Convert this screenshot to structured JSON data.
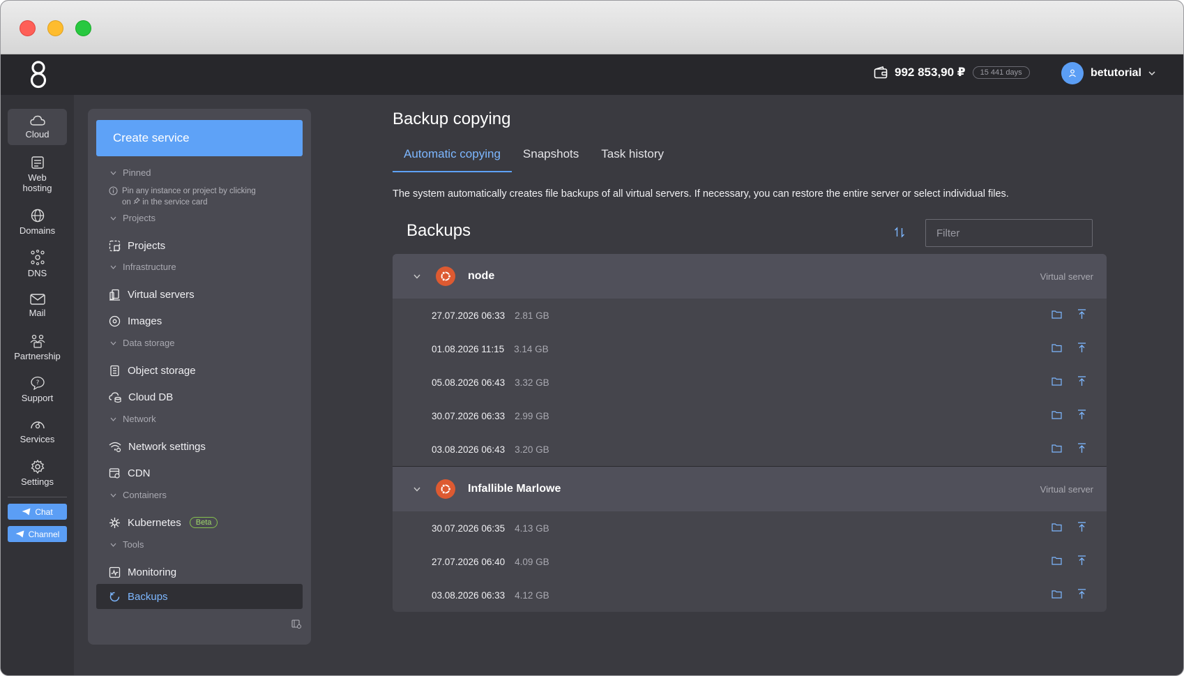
{
  "header": {
    "balance": "992 853,90 ₽",
    "days": "15 441 days",
    "username": "betutorial"
  },
  "rail": {
    "items": [
      {
        "label": "Cloud",
        "icon": "cloud-icon"
      },
      {
        "label": "Web hosting",
        "icon": "web-hosting-icon"
      },
      {
        "label": "Domains",
        "icon": "globe-icon"
      },
      {
        "label": "DNS",
        "icon": "dns-icon"
      },
      {
        "label": "Mail",
        "icon": "mail-icon"
      },
      {
        "label": "Partnership",
        "icon": "partnership-icon"
      },
      {
        "label": "Support",
        "icon": "support-icon"
      },
      {
        "label": "Services",
        "icon": "services-icon"
      },
      {
        "label": "Settings",
        "icon": "gear-icon"
      }
    ],
    "chat_label": "Chat",
    "channel_label": "Channel"
  },
  "panel": {
    "create_label": "Create service",
    "sections": {
      "pinned": "Pinned",
      "projects": "Projects",
      "infrastructure": "Infrastructure",
      "data_storage": "Data storage",
      "network": "Network",
      "containers": "Containers",
      "tools": "Tools"
    },
    "pinned_hint_1": "Pin any instance or project by clicking",
    "pinned_hint_2": "on",
    "pinned_hint_3": "in the service card",
    "items": {
      "projects": "Projects",
      "virtual_servers": "Virtual servers",
      "images": "Images",
      "object_storage": "Object storage",
      "cloud_db": "Cloud DB",
      "network_settings": "Network settings",
      "cdn": "CDN",
      "kubernetes": "Kubernetes",
      "beta": "Beta",
      "monitoring": "Monitoring",
      "backups": "Backups"
    }
  },
  "main": {
    "title": "Backup copying",
    "tabs": [
      "Automatic copying",
      "Snapshots",
      "Task history"
    ],
    "description": "The system automatically creates file backups of all virtual servers. If necessary, you can restore the entire server or select individual files.",
    "backups_title": "Backups",
    "filter_placeholder": "Filter",
    "groups": [
      {
        "name": "node",
        "type": "Virtual server",
        "rows": [
          {
            "date": "27.07.2026 06:33",
            "size": "2.81 GB"
          },
          {
            "date": "01.08.2026 11:15",
            "size": "3.14 GB"
          },
          {
            "date": "05.08.2026 06:43",
            "size": "3.32 GB"
          },
          {
            "date": "30.07.2026 06:33",
            "size": "2.99 GB"
          },
          {
            "date": "03.08.2026 06:43",
            "size": "3.20 GB"
          }
        ]
      },
      {
        "name": "Infallible Marlowe",
        "type": "Virtual server",
        "rows": [
          {
            "date": "30.07.2026 06:35",
            "size": "4.13 GB"
          },
          {
            "date": "27.07.2026 06:40",
            "size": "4.09 GB"
          },
          {
            "date": "03.08.2026 06:33",
            "size": "4.12 GB"
          }
        ]
      }
    ]
  },
  "colors": {
    "accent": "#5ea2f7",
    "ubuntu": "#dd5a31"
  }
}
